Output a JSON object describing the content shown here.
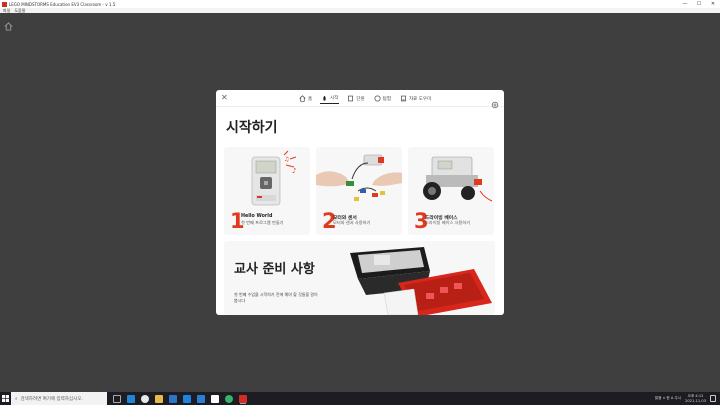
{
  "window": {
    "title": "LEGO MINDSTORMS Education EV3 Classroom - v 1.5",
    "menu": [
      "파일",
      "도움말"
    ],
    "controls": [
      "—",
      "☐",
      "✕"
    ]
  },
  "dialog": {
    "nav": [
      {
        "label": "홈",
        "icon": "home-icon",
        "active": false
      },
      {
        "label": "시작",
        "icon": "rocket-icon",
        "active": true
      },
      {
        "label": "단원",
        "icon": "book-icon",
        "active": false
      },
      {
        "label": "탐험",
        "icon": "compass-icon",
        "active": false
      },
      {
        "label": "자료 도우미",
        "icon": "document-icon",
        "active": false
      }
    ],
    "title": "시작하기",
    "cards": [
      {
        "number": "1",
        "title": "Hello World",
        "subtitle": "첫 번째 프로그램 만들기"
      },
      {
        "number": "2",
        "title": "모터와 센서",
        "subtitle": "모터와 센서 사용하기"
      },
      {
        "number": "3",
        "title": "드라이빙 베이스",
        "subtitle": "드라이빙 베이스 사용하기"
      }
    ],
    "teacher": {
      "title": "교사 준비 사항",
      "description": "첫 번째 수업을 시작하기 전에 해야 할 것들을 알아봅시다"
    }
  },
  "taskbar": {
    "search_placeholder": "검색하려면 여기에 입력하십시오.",
    "tray_text": "맑음 ∧ 한 A 주시",
    "clock_time": "오후 4:12",
    "clock_date": "2021-11-03"
  },
  "colors": {
    "accent_red": "#e03a1e",
    "background": "#3f3f3f"
  }
}
